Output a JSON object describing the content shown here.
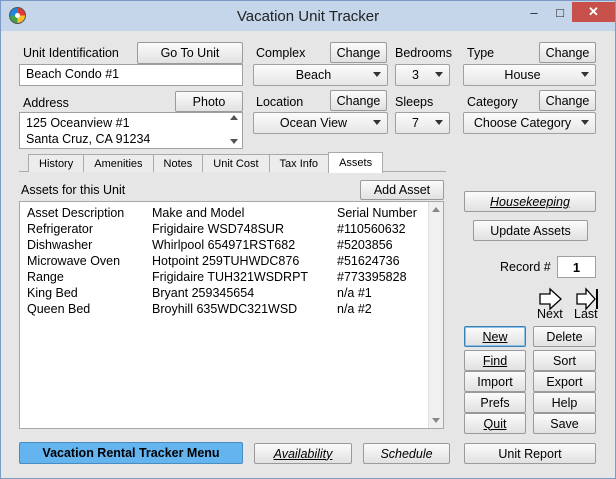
{
  "window": {
    "title": "Vacation Unit Tracker",
    "minimize": "–",
    "maximize": "□",
    "close": "✕"
  },
  "unit": {
    "label": "Unit Identification",
    "goto_button": "Go To Unit",
    "value": "Beach Condo #1"
  },
  "address": {
    "label": "Address",
    "photo_button": "Photo",
    "lines": [
      "125 Oceanview #1",
      "Santa Cruz, CA 91234"
    ]
  },
  "complex": {
    "label": "Complex",
    "change_button": "Change",
    "value": "Beach"
  },
  "location": {
    "label": "Location",
    "change_button": "Change",
    "value": "Ocean View"
  },
  "bedrooms": {
    "label": "Bedrooms",
    "value": "3"
  },
  "sleeps": {
    "label": "Sleeps",
    "value": "7"
  },
  "type": {
    "label": "Type",
    "change_button": "Change",
    "value": "House"
  },
  "category": {
    "label": "Category",
    "change_button": "Change",
    "value": "Choose Category"
  },
  "tabs": [
    "History",
    "Amenities",
    "Notes",
    "Unit Cost",
    "Tax Info",
    "Assets"
  ],
  "active_tab": "Assets",
  "assets": {
    "label": "Assets for this Unit",
    "add_button": "Add Asset",
    "columns": [
      "Asset Description",
      "Make and Model",
      "Serial Number"
    ],
    "rows": [
      [
        "Refrigerator",
        "Frigidaire WSD748SUR",
        "#110560632"
      ],
      [
        "Dishwasher",
        "Whirlpool 654971RST682",
        "#5203856"
      ],
      [
        "Microwave Oven",
        "Hotpoint 259TUHWDC876",
        "#51624736"
      ],
      [
        "Range",
        "Frigidaire TUH321WSDRPT",
        "#773395828"
      ],
      [
        "King Bed",
        "Bryant 259345654",
        "n/a #1"
      ],
      [
        "Queen Bed",
        "Broyhill 635WDC321WSD",
        "n/a #2"
      ]
    ]
  },
  "side": {
    "housekeeping": "Housekeeping",
    "update_assets": "Update Assets",
    "record_label": "Record #",
    "record_value": "1",
    "next_label": "Next",
    "last_label": "Last"
  },
  "actions": {
    "new": "New",
    "delete": "Delete",
    "find": "Find",
    "sort": "Sort",
    "import": "Import",
    "export": "Export",
    "prefs": "Prefs",
    "help": "Help",
    "quit": "Quit",
    "save": "Save"
  },
  "footer": {
    "menu": "Vacation Rental Tracker Menu",
    "availability": "Availability",
    "schedule": "Schedule",
    "unit_report": "Unit Report"
  }
}
